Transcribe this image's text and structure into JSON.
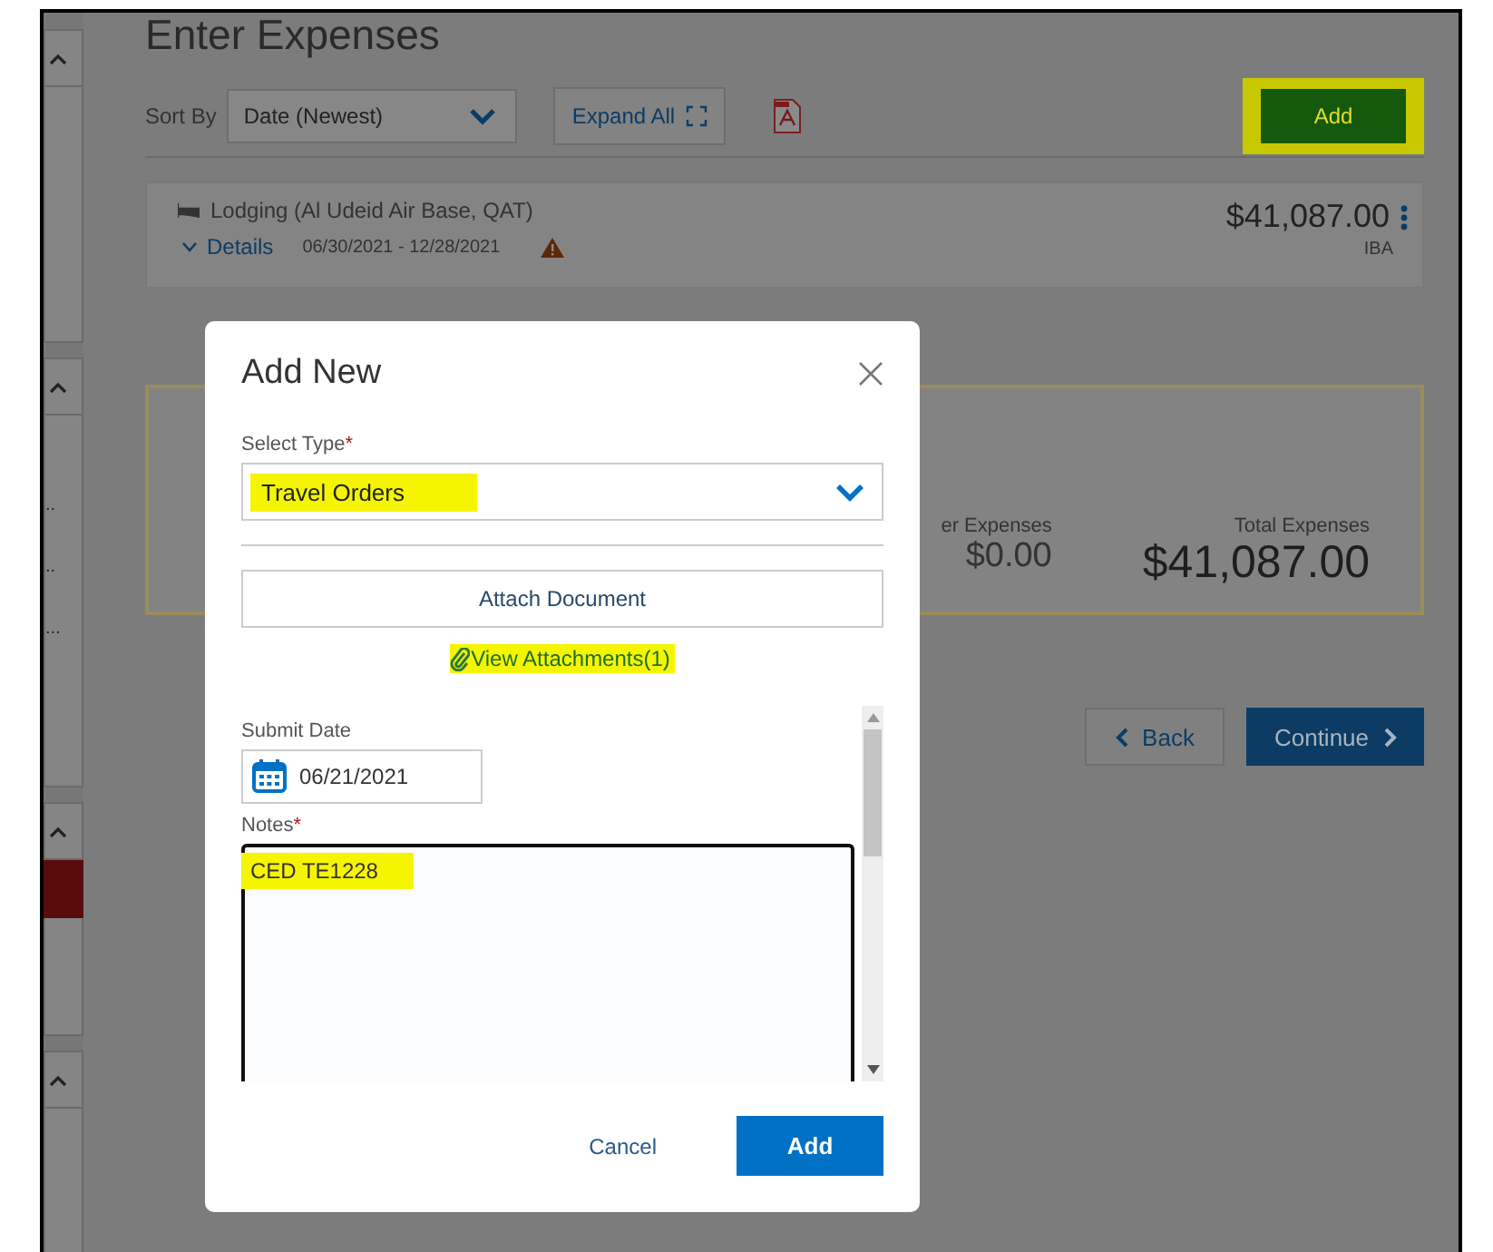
{
  "sidebar": {
    "items": [
      "..",
      "..",
      "..."
    ]
  },
  "page": {
    "title": "Enter Expenses",
    "sort_label": "Sort By",
    "sort_value": "Date (Newest)",
    "expand_button": "Expand All",
    "add_button": {
      "label": "Add",
      "highlighted": true
    }
  },
  "expense": {
    "title": "Lodging (Al Udeid Air Base, QAT)",
    "details_link": "Details",
    "dates": "06/30/2021 - 12/28/2021",
    "warning": true,
    "amount": "$41,087.00",
    "payment": "IBA"
  },
  "summary": {
    "columns": [
      {
        "label": "er Expenses",
        "value": "$0.00"
      },
      {
        "label": "Total Expenses",
        "value": "$41,087.00"
      }
    ]
  },
  "nav": {
    "back": "Back",
    "continue": "Continue"
  },
  "modal": {
    "title": "Add New",
    "type_field": {
      "label": "Select Type",
      "required_mark": "*",
      "value": "Travel Orders",
      "highlighted": true
    },
    "attach_button": "Attach Document",
    "attachments_link": {
      "label": "View Attachments(1)",
      "highlighted": true
    },
    "date_field": {
      "label": "Submit Date",
      "value": "06/21/2021"
    },
    "notes_field": {
      "label": "Notes",
      "required_mark": "*",
      "value": "CED TE1228",
      "highlighted": true
    },
    "cancel": "Cancel",
    "add": "Add"
  }
}
